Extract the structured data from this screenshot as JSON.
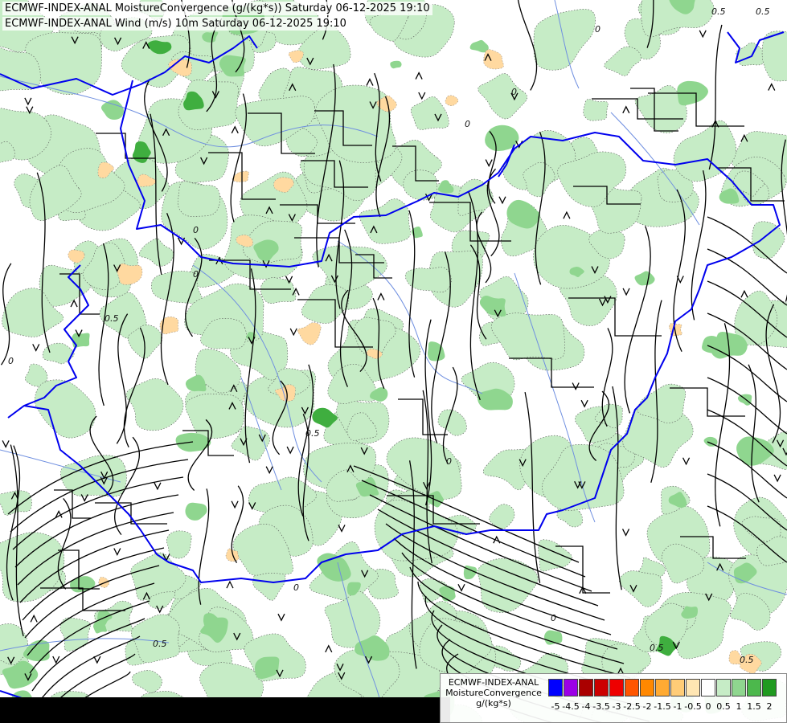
{
  "titles": {
    "line1": "ECMWF-INDEX-ANAL MoistureConvergence (g/(kg*s)) Saturday 06-12-2025 19:10",
    "line2": "ECMWF-INDEX-ANAL Wind (m/s) 10m Saturday 06-12-2025 19:10"
  },
  "legend": {
    "model": "ECMWF-INDEX-ANAL",
    "parameter": "MoistureConvergence",
    "unit": "g/(kg*s)",
    "tick_labels": [
      "-5",
      "-4.5",
      "-4",
      "-3.5",
      "-3",
      "-2.5",
      "-2",
      "-1.5",
      "-1",
      "-0.5",
      "0",
      "0.5",
      "1",
      "1.5",
      "2"
    ],
    "colors": [
      "#0000ff",
      "#9b00e6",
      "#aa0000",
      "#cc0000",
      "#ee0000",
      "#ff5500",
      "#ff8800",
      "#ffaa33",
      "#ffcc77",
      "#ffe6b3",
      "#ffffff",
      "#c6ecc6",
      "#8fd68f",
      "#4cb84c",
      "#1f9a1f"
    ]
  },
  "map_style": {
    "border_color": "#0000ee",
    "river_color": "#6f8fe0",
    "streamline_color": "#000000",
    "positive_fill": "#c6ecc6",
    "strong_positive_fill": "#8fd68f",
    "very_strong_fill": "#3fae3f",
    "negative_fill": "#ffd9a0",
    "dark_strip_color": "#000000"
  },
  "contour_labels": [
    "0.5",
    "0.5",
    "0.5",
    "0.5",
    "0.5",
    "0.5",
    "0.5",
    "0",
    "0",
    "0",
    "0",
    "0",
    "0",
    "0",
    "0",
    "0"
  ]
}
